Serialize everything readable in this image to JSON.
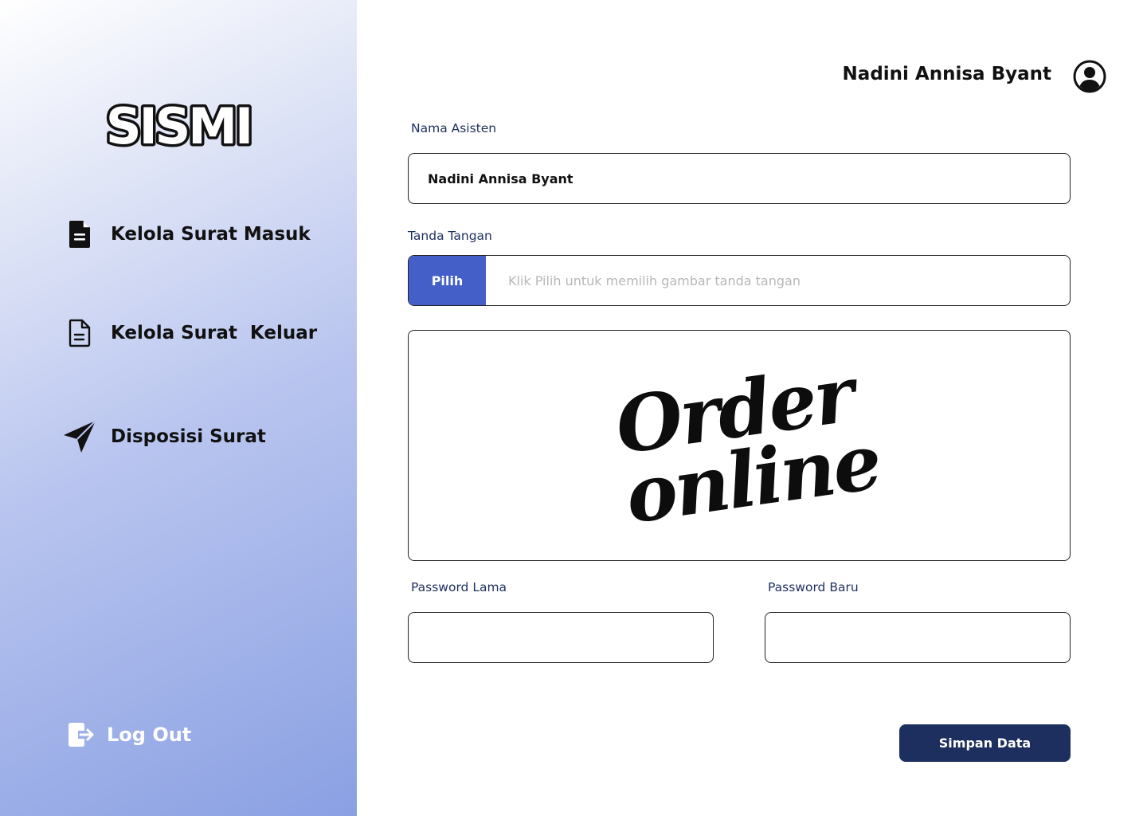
{
  "app": {
    "logo_text": "SISMI"
  },
  "sidebar": {
    "items": [
      {
        "label": "Kelola Surat Masuk",
        "icon": "file-text-filled-icon"
      },
      {
        "label": "Kelola Surat  Keluar",
        "icon": "file-text-outline-icon"
      },
      {
        "label": "Disposisi Surat",
        "icon": "paper-plane-icon"
      }
    ],
    "logout_label": "Log Out",
    "logout_icon": "logout-icon"
  },
  "header": {
    "user_name": "Nadini Annisa Byant",
    "avatar_icon": "user-circle-icon"
  },
  "form": {
    "nama_label": "Nama Asisten",
    "nama_value": "Nadini Annisa Byant",
    "ttd_label": "Tanda Tangan",
    "pick_button": "Pilih",
    "pick_hint": "Klik Pilih untuk memilih gambar tanda tangan",
    "signature_line1": "Order",
    "signature_line2": "online",
    "pw_lama_label": "Password Lama",
    "pw_lama_value": "",
    "pw_baru_label": "Password Baru",
    "pw_baru_value": "",
    "save_button": "Simpan Data"
  },
  "colors": {
    "accent": "#445fc8",
    "primary_dark": "#1d2f5e",
    "label_text": "#1d2f5e",
    "hint_text": "#b7b7b7"
  }
}
